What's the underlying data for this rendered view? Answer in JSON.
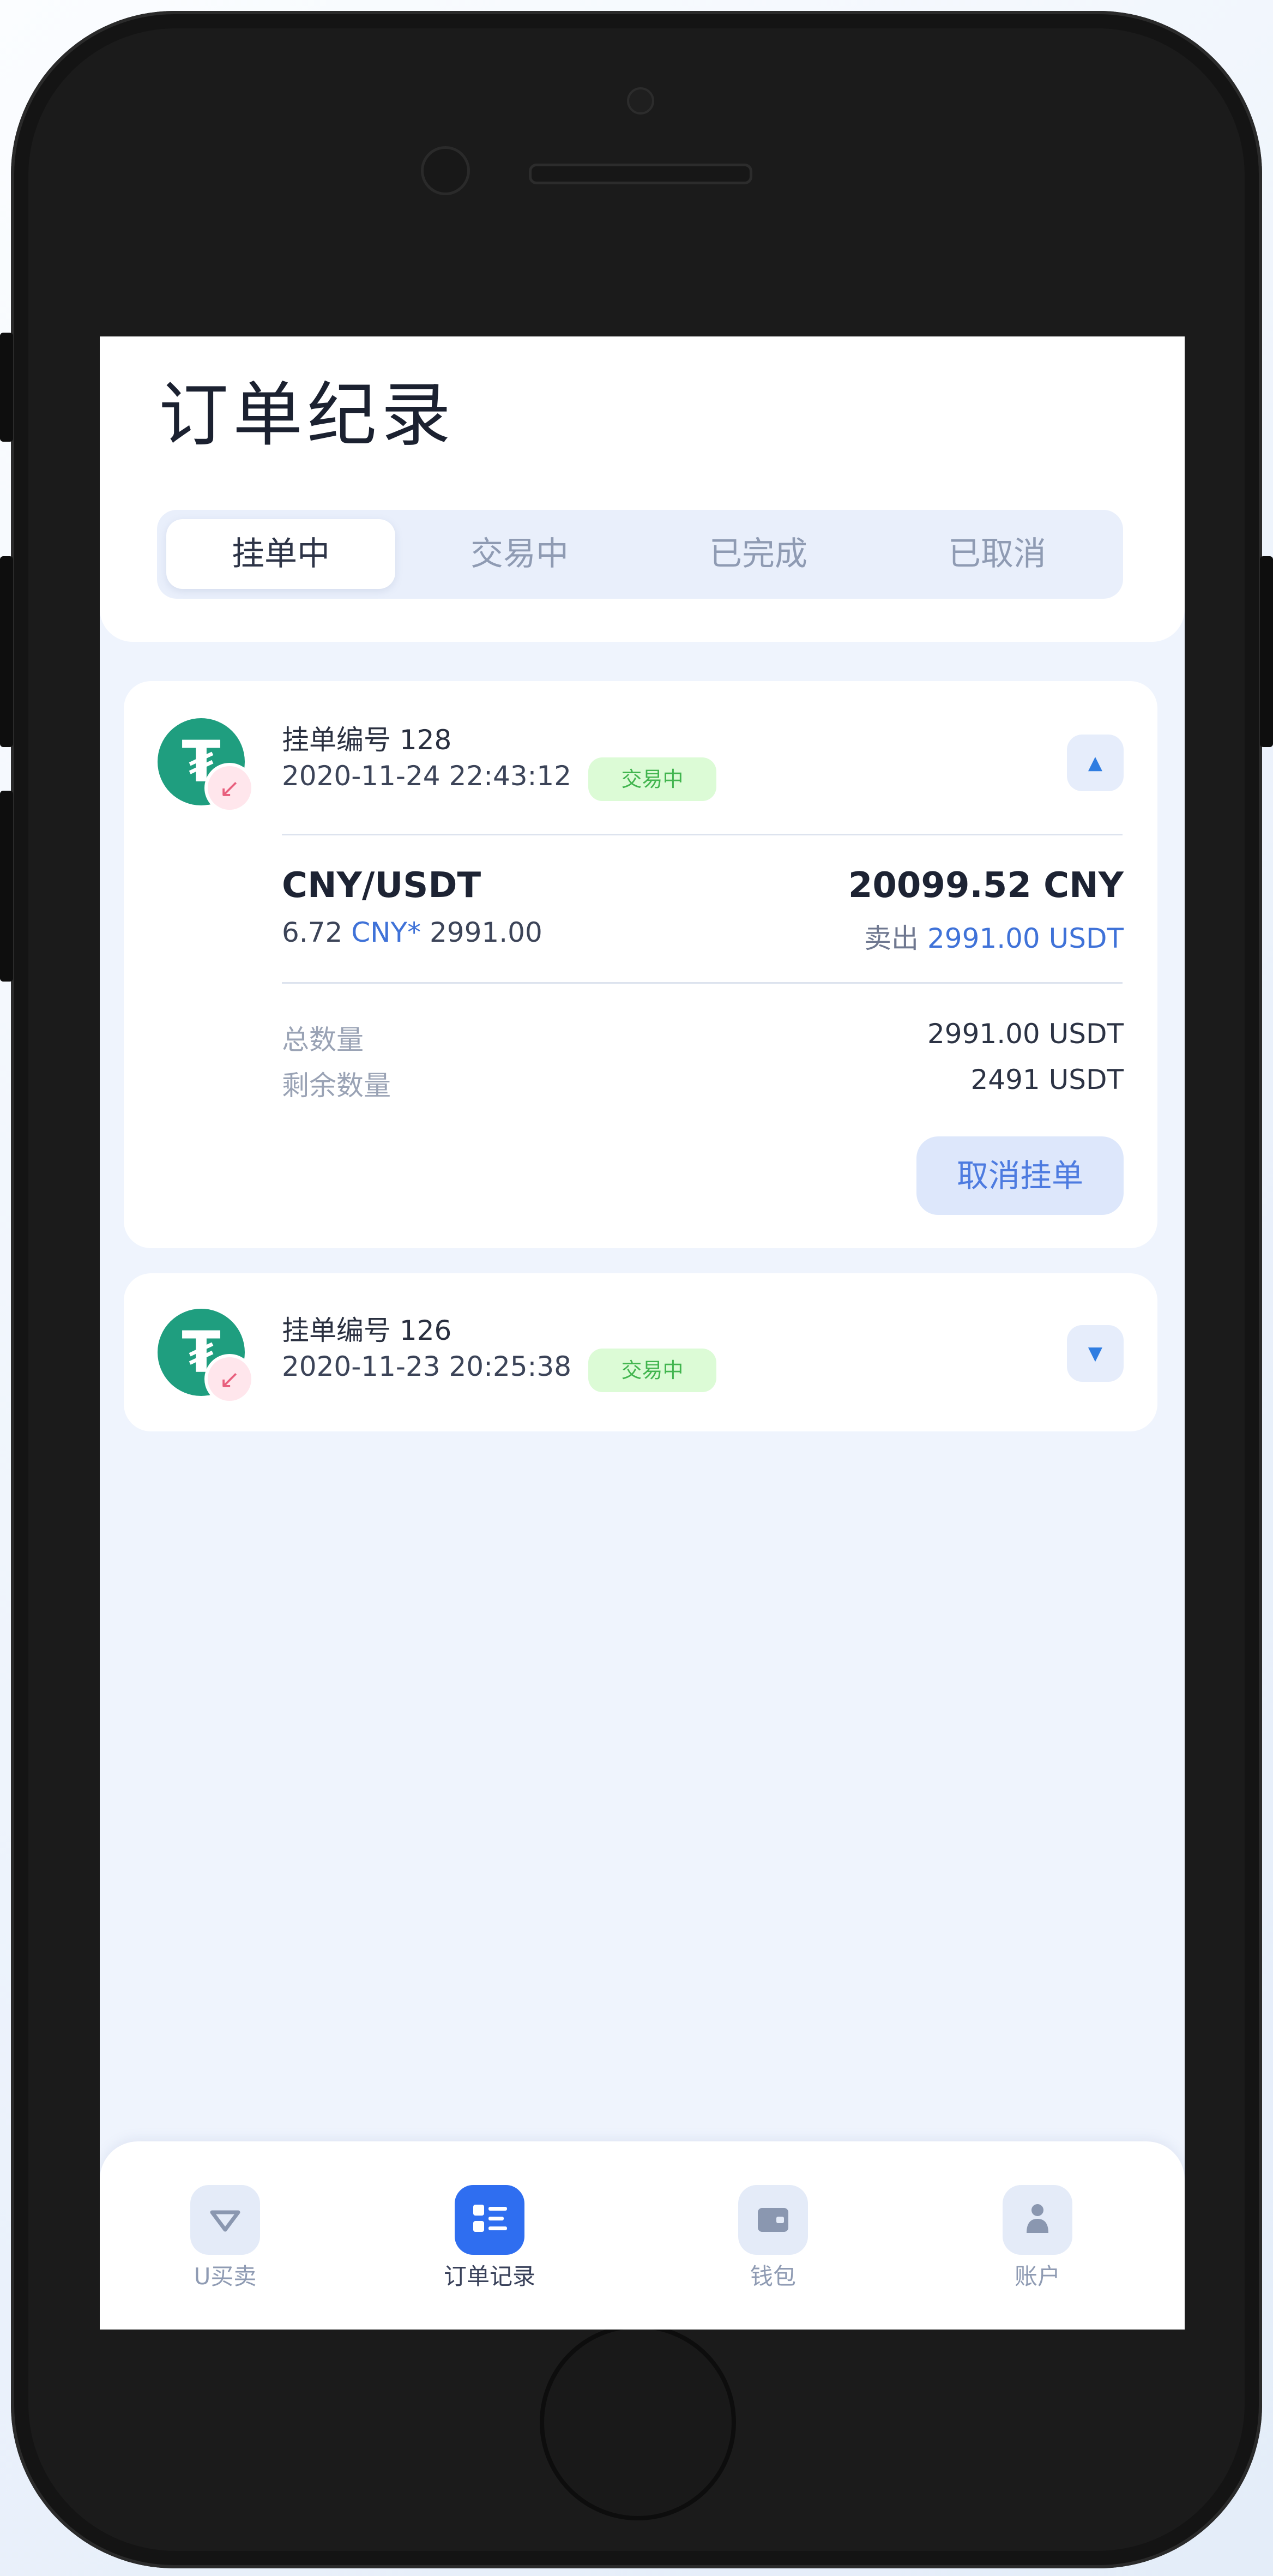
{
  "page": {
    "title": "订单纪录"
  },
  "tabs": [
    {
      "label": "挂单中",
      "active": true
    },
    {
      "label": "交易中",
      "active": false
    },
    {
      "label": "已完成",
      "active": false
    },
    {
      "label": "已取消",
      "active": false
    }
  ],
  "orders": [
    {
      "order_no": "挂单编号 128",
      "time": "2020-11-24 22:43:12",
      "status": "交易中",
      "expanded": true,
      "pair": "CNY/USDT",
      "total": "20099.52 CNY",
      "rate_prefix": "6.72",
      "rate_currency": "CNY*",
      "rate_amount": "2991.00",
      "side_prefix": "卖出",
      "side_amount": "2991.00 USDT",
      "total_qty_label": "总数量",
      "total_qty_value": "2991.00 USDT",
      "remaining_qty_label": "剩余数量",
      "remaining_qty_value": "2491 USDT",
      "cancel_label": "取消挂单"
    },
    {
      "order_no": "挂单编号 126",
      "time": "2020-11-23 20:25:38",
      "status": "交易中",
      "expanded": false
    }
  ],
  "coin": {
    "symbol": "₮",
    "icon": "tether-icon",
    "badge_icon": "arrow-down-left-icon"
  },
  "bottom_nav": [
    {
      "label": "U买卖",
      "icon": "diamond-icon",
      "active": false
    },
    {
      "label": "订单记录",
      "icon": "list-icon",
      "active": true
    },
    {
      "label": "钱包",
      "icon": "wallet-icon",
      "active": false
    },
    {
      "label": "账户",
      "icon": "user-icon",
      "active": false
    }
  ],
  "colors": {
    "accent": "#2f6ef0",
    "tether_green": "#1f9e7f",
    "status_green": "#42b54f",
    "link_blue": "#3f72d8"
  }
}
